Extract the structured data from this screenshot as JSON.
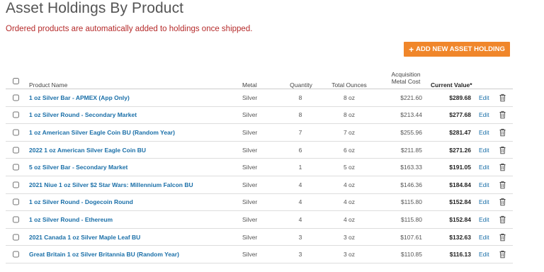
{
  "page": {
    "title": "Asset Holdings By Product",
    "notice": "Ordered products are automatically added to holdings once shipped.",
    "add_button_label": "ADD NEW ASSET HOLDING"
  },
  "colors": {
    "accent": "#f0862a",
    "link": "#1a6fa8",
    "notice": "#b52a2a"
  },
  "table": {
    "headers": {
      "product": "Product Name",
      "metal": "Metal",
      "quantity": "Quantity",
      "ounces": "Total Ounces",
      "cost_line1": "Acquisition",
      "cost_line2": "Metal Cost",
      "value": "Current Value*"
    },
    "edit_label": "Edit",
    "rows": [
      {
        "name": "1 oz Silver Bar - APMEX (App Only)",
        "metal": "Silver",
        "qty": "8",
        "oz": "8 oz",
        "cost": "$221.60",
        "value": "$289.68"
      },
      {
        "name": "1 oz Silver Round - Secondary Market",
        "metal": "Silver",
        "qty": "8",
        "oz": "8 oz",
        "cost": "$213.44",
        "value": "$277.68"
      },
      {
        "name": "1 oz American Silver Eagle Coin BU (Random Year)",
        "metal": "Silver",
        "qty": "7",
        "oz": "7 oz",
        "cost": "$255.96",
        "value": "$281.47"
      },
      {
        "name": "2022 1 oz American Silver Eagle Coin BU",
        "metal": "Silver",
        "qty": "6",
        "oz": "6 oz",
        "cost": "$211.85",
        "value": "$271.26"
      },
      {
        "name": "5 oz Silver Bar - Secondary Market",
        "metal": "Silver",
        "qty": "1",
        "oz": "5 oz",
        "cost": "$163.33",
        "value": "$191.05"
      },
      {
        "name": "2021 Niue 1 oz Silver $2 Star Wars: Millennium Falcon BU",
        "metal": "Silver",
        "qty": "4",
        "oz": "4 oz",
        "cost": "$146.36",
        "value": "$184.84"
      },
      {
        "name": "1 oz Silver Round - Dogecoin Round",
        "metal": "Silver",
        "qty": "4",
        "oz": "4 oz",
        "cost": "$115.80",
        "value": "$152.84"
      },
      {
        "name": "1 oz Silver Round - Ethereum",
        "metal": "Silver",
        "qty": "4",
        "oz": "4 oz",
        "cost": "$115.80",
        "value": "$152.84"
      },
      {
        "name": "2021 Canada 1 oz Silver Maple Leaf BU",
        "metal": "Silver",
        "qty": "3",
        "oz": "3 oz",
        "cost": "$107.61",
        "value": "$132.63"
      },
      {
        "name": "Great Britain 1 oz Silver Britannia BU (Random Year)",
        "metal": "Silver",
        "qty": "3",
        "oz": "3 oz",
        "cost": "$110.85",
        "value": "$116.13"
      }
    ]
  }
}
